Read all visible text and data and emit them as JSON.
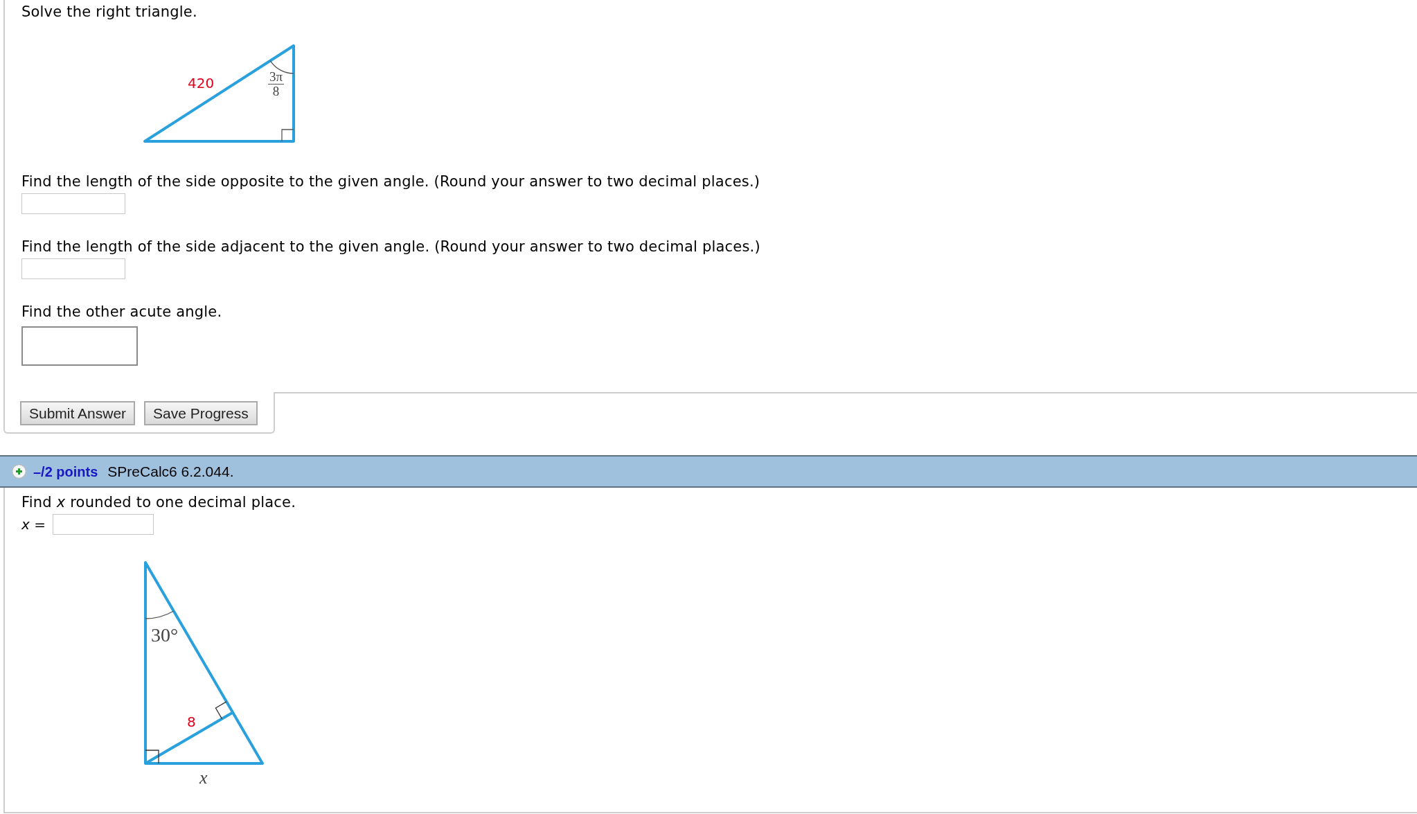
{
  "question_1": {
    "instruction": "Solve the right triangle.",
    "figure": {
      "hypotenuse_label": "420",
      "angle_label": {
        "numerator": "3π",
        "denominator": "8"
      }
    },
    "parts": [
      {
        "kind": "decimal",
        "prompt": "Find the length of the side opposite to the given angle. (Round your answer to two decimal places.)"
      },
      {
        "kind": "decimal",
        "prompt": "Find the length of the side adjacent to the given angle. (Round your answer to two decimal places.)"
      },
      {
        "kind": "angle",
        "prompt": "Find the other acute angle."
      }
    ],
    "buttons": [
      "Submit Answer",
      "Save Progress"
    ]
  },
  "question_2": {
    "header": {
      "points": "–/2 points",
      "source": "SPreCalc6 6.2.044."
    },
    "prompt": "Find *x* rounded to one decimal place.",
    "answer_label": "*x* =",
    "figure": {
      "angle_label": "30°",
      "altitude_label": "8",
      "base_label": "x"
    }
  }
}
